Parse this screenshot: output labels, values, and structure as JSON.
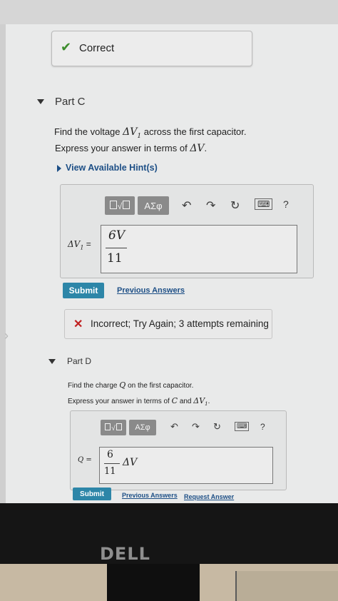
{
  "status_correct": {
    "icon": "checkmark-icon",
    "label": "Correct"
  },
  "part_c": {
    "title": "Part C",
    "prompt_before": "Find the voltage",
    "prompt_var": "ΔV",
    "prompt_sub": "1",
    "prompt_after": "across the first capacitor.",
    "express_before": "Express your answer in terms of",
    "express_var": "ΔV",
    "express_after": ".",
    "hint_link": "View Available Hint(s)",
    "toolbar": {
      "templates_icon": "math-templates-icon",
      "symbols_label": "ΑΣφ",
      "help_label": "?"
    },
    "answer_label": "ΔV",
    "answer_label_sub": "1",
    "answer_label_eq": "=",
    "fraction_num": "6V",
    "fraction_den": "11",
    "submit": "Submit",
    "previous_answers": "Previous Answers"
  },
  "feedback_incorrect": {
    "icon": "x-icon",
    "label": "Incorrect; Try Again; 3 attempts remaining"
  },
  "part_d": {
    "title": "Part D",
    "prompt_before": "Find the charge",
    "prompt_var": "Q",
    "prompt_after": "on the first capacitor.",
    "express_before": "Express your answer in terms of",
    "express_var1": "C",
    "express_and": "and",
    "express_var2": "ΔV",
    "express_sub": "1",
    "express_after": ".",
    "toolbar": {
      "templates_icon": "math-templates-icon",
      "symbols_label": "ΑΣφ",
      "help_label": "?"
    },
    "answer_label": "Q =",
    "fraction_num": "6",
    "fraction_den": "11",
    "fraction_tail": "ΔV",
    "submit": "Submit",
    "previous_answers": "Previous Answers",
    "request_answer": "Request Answer"
  },
  "monitor_brand": "DELL",
  "colors": {
    "link": "#1d4f86",
    "submit_bg": "#2d86a8",
    "correct": "#3c8c2c",
    "incorrect": "#c02020"
  }
}
